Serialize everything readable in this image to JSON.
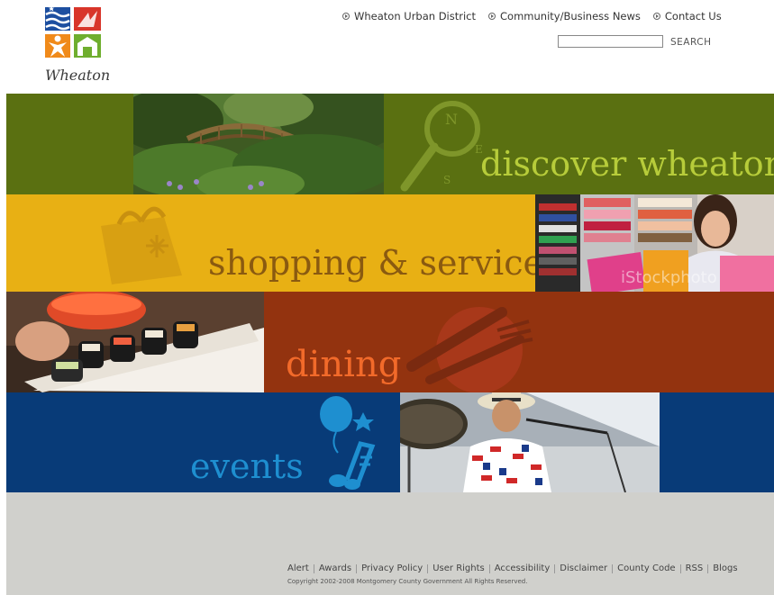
{
  "logo": {
    "text": "Wheaton"
  },
  "top_nav": [
    {
      "label": "Wheaton Urban District"
    },
    {
      "label": "Community/Business News"
    },
    {
      "label": "Contact Us"
    }
  ],
  "search": {
    "button_label": "SEARCH",
    "value": ""
  },
  "banners": {
    "discover": {
      "label": "discover wheaton",
      "color": "#5a7011",
      "text_color": "#b7cc3a"
    },
    "shopping": {
      "label": "shopping & services",
      "color": "#e8b014",
      "text_color": "#8a5a10"
    },
    "dining": {
      "label": "dining",
      "color": "#93330f",
      "text_color": "#f26a2a"
    },
    "events": {
      "label": "events",
      "color": "#083b78",
      "text_color": "#1e8fd0"
    }
  },
  "watermark": "iStockphoto",
  "footer": {
    "links": [
      "Alert",
      "Awards",
      "Privacy Policy",
      "User Rights",
      "Accessibility",
      "Disclaimer",
      "County Code",
      "RSS",
      "Blogs"
    ],
    "copyright": "Copyright 2002-2008 Montgomery County Government All Rights Reserved."
  }
}
